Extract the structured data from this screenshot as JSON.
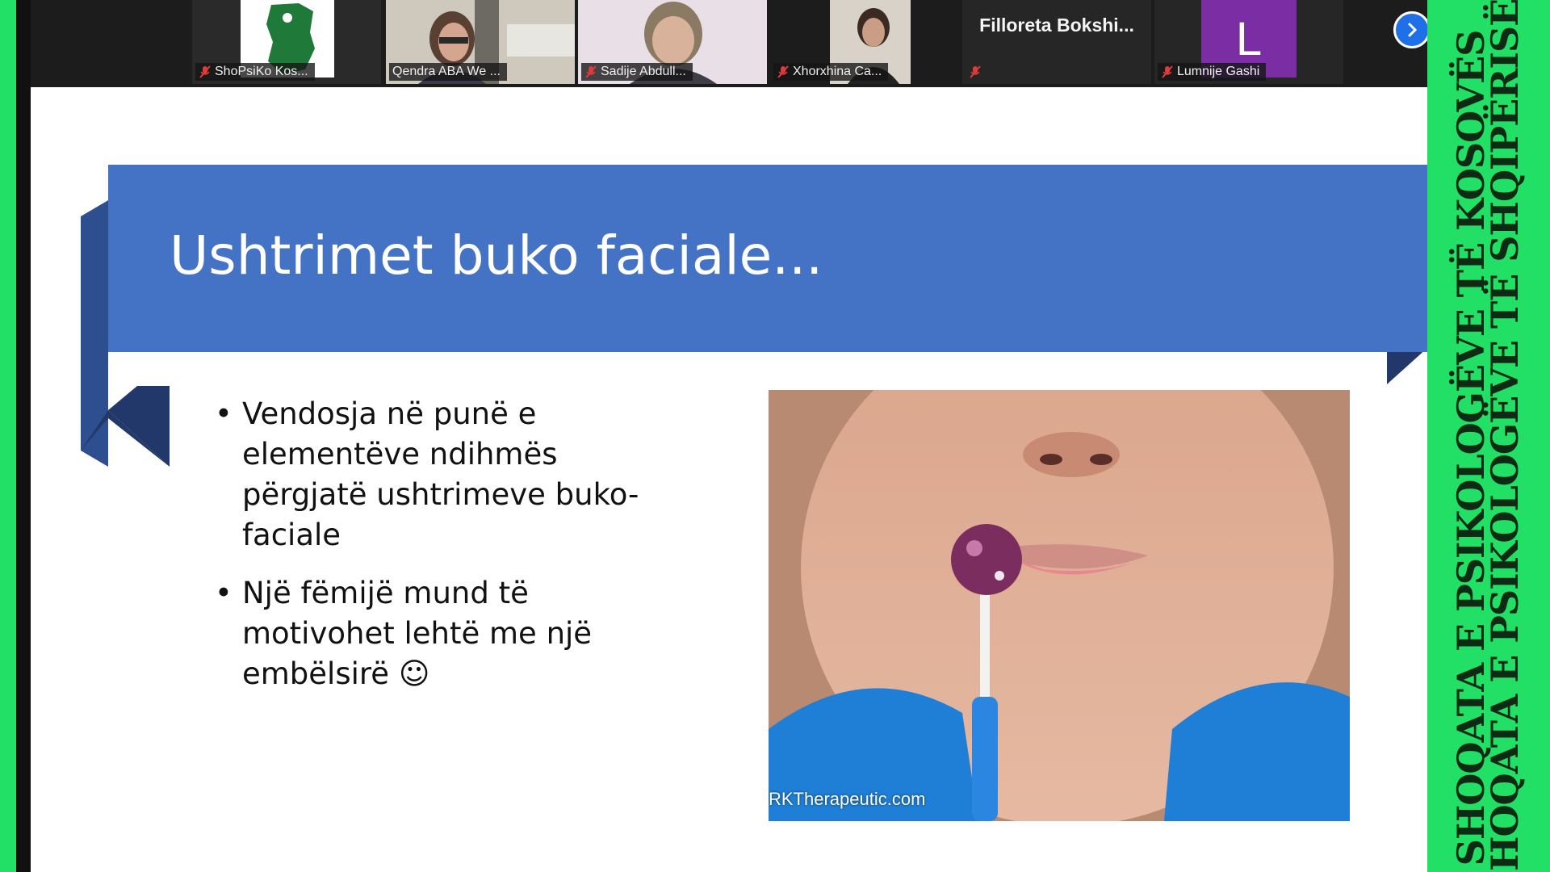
{
  "participants": [
    {
      "name": "ShoPsiKo Kos...",
      "muted": true,
      "active": true
    },
    {
      "name": "Qendra ABA We ...",
      "muted": false
    },
    {
      "name": "Sadije Abdull...",
      "muted": true
    },
    {
      "name": "Xhorxhina Ca...",
      "muted": true
    },
    {
      "name": "Filloreta  Bokshi...",
      "muted": true,
      "video": false
    },
    {
      "name": "Lumnije Gashi",
      "muted": true,
      "avatar_letter": "L"
    }
  ],
  "controls": {
    "next_icon": "chevron-right-icon"
  },
  "slide": {
    "title": "Ushtrimet buko faciale...",
    "bullets": [
      "Vendosja në punë e elementëve ndihmës përgjatë ushtrimeve buko-faciale",
      "Një fëmijë mund të motivohet lehtë me një embëlsirë ☺"
    ],
    "image_credit": "RKTherapeutic.com"
  },
  "banner": {
    "line1": "SHOQATA E PSIKOLOGËVE TË KOSOVËS",
    "line2": "SHOQATA E PSIKOLOGËVE TË SHQIPËRISË"
  },
  "colors": {
    "frame_green": "#22e066",
    "title_blue": "#4472c4",
    "ribbon_dark": "#2e4f8f",
    "avatar_purple": "#7b2ea3"
  }
}
